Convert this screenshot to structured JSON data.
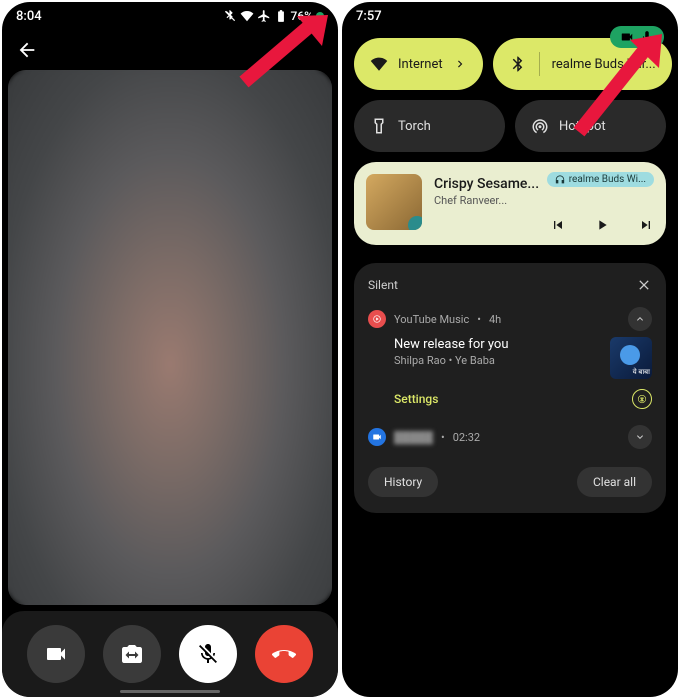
{
  "left": {
    "time": "8:04",
    "battery": "76%"
  },
  "right": {
    "time": "7:57",
    "qs": {
      "internet": "Internet",
      "bt": "realme Buds Wir...",
      "torch": "Torch",
      "hotspot": "Hotspot"
    },
    "media": {
      "device": "realme Buds Wi...",
      "title": "Crispy Sesame...",
      "artist": "Chef Ranveer..."
    },
    "notif": {
      "section": "Silent",
      "app1": "YouTube Music",
      "time1": "4h",
      "title1": "New release for you",
      "sub1a": "Shilpa Rao",
      "sub1b": "Ye Baba",
      "thumb_text": "ये बाबा",
      "settings": "Settings",
      "time2": "02:32",
      "history": "History",
      "clear": "Clear all"
    }
  }
}
